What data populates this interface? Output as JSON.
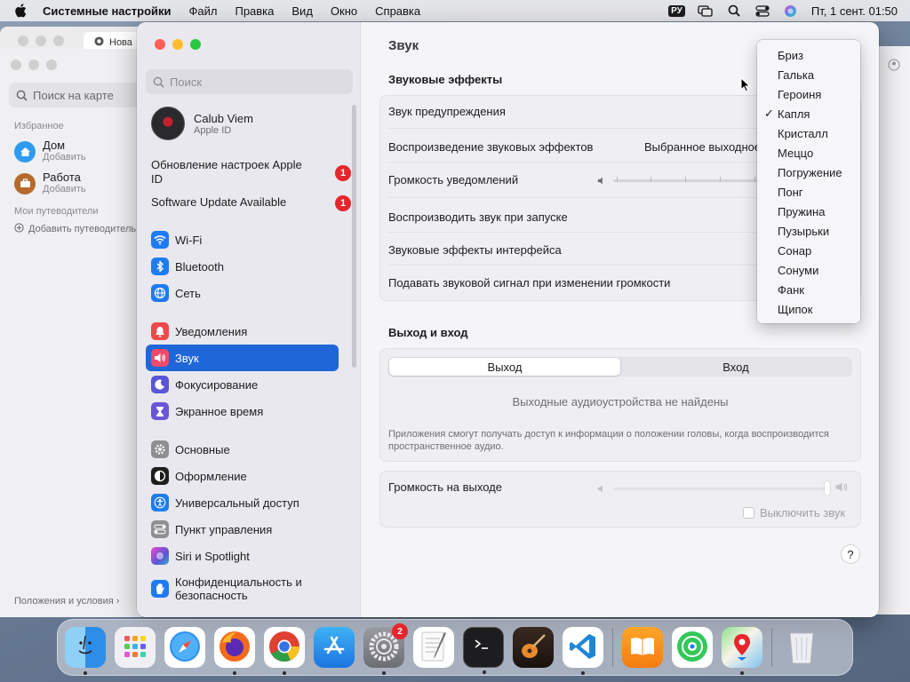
{
  "menubar": {
    "app_name": "Системные настройки",
    "items": [
      "Файл",
      "Правка",
      "Вид",
      "Окно",
      "Справка"
    ],
    "lang": "РУ",
    "clock": "Пт, 1 сент. 01:50"
  },
  "browser_tab": {
    "label": "Нова"
  },
  "maps": {
    "search_placeholder": "Поиск на карте",
    "favorites_title": "Избранное",
    "home_label": "Дом",
    "home_sub": "Добавить",
    "work_label": "Работа",
    "work_sub": "Добавить",
    "guides_title": "Мои путеводители",
    "add_guide": "Добавить путеводитель",
    "terms": "Положения и условия"
  },
  "sidebar": {
    "search_placeholder": "Поиск",
    "account": {
      "name": "Calub Viem",
      "sub": "Apple ID"
    },
    "notices": [
      {
        "label": "Обновление настроек Apple ID",
        "badge": "1"
      },
      {
        "label": "Software Update Available",
        "badge": "1"
      }
    ],
    "items": [
      {
        "label": "Wi-Fi",
        "icon": "wifi-icon",
        "color": "#1f7bf2"
      },
      {
        "label": "Bluetooth",
        "icon": "bluetooth-icon",
        "color": "#1f7bf2"
      },
      {
        "label": "Сеть",
        "icon": "globe-icon",
        "color": "#1f7bf2"
      },
      {
        "label": "Уведомления",
        "icon": "bell-icon",
        "color": "#ee4a4a"
      },
      {
        "label": "Звук",
        "icon": "speaker-icon",
        "color": "#ee4a6a"
      },
      {
        "label": "Фокусирование",
        "icon": "moon-icon",
        "color": "#5a54d6"
      },
      {
        "label": "Экранное время",
        "icon": "hourglass-icon",
        "color": "#6a55d6"
      },
      {
        "label": "Основные",
        "icon": "gear-icon",
        "color": "#8e8e93"
      },
      {
        "label": "Оформление",
        "icon": "appearance-icon",
        "color": "#1d1d1f"
      },
      {
        "label": "Универсальный доступ",
        "icon": "accessibility-icon",
        "color": "#1f7bf2"
      },
      {
        "label": "Пункт управления",
        "icon": "control-center-icon",
        "color": "#8e8e93"
      },
      {
        "label": "Siri и Spotlight",
        "icon": "siri-icon",
        "color": "#b04ad9"
      },
      {
        "label": "Конфиденциальность и безопасность",
        "icon": "hand-icon",
        "color": "#1f7bf2"
      }
    ]
  },
  "content": {
    "title": "Звук",
    "effects_title": "Звуковые эффекты",
    "alert_sound": "Звук предупреждения",
    "play_effects": "Воспроизведение звуковых эффектов",
    "play_effects_value": "Выбранное выходное",
    "alert_volume": "Громкость уведомлений",
    "startup_sound": "Воспроизводить звук при запуске",
    "ui_effects": "Звуковые эффекты интерфейса",
    "volume_feedback": "Подавать звуковой сигнал при изменении громкости",
    "io_title": "Выход и вход",
    "tab_output": "Выход",
    "tab_input": "Вход",
    "no_devices": "Выходные аудиоустройства не найдены",
    "spatial_info": "Приложения смогут получать доступ к информации о положении головы, когда воспроизводится пространственное аудио.",
    "output_volume": "Громкость на выходе",
    "mute": "Выключить звук",
    "help": "?"
  },
  "dropdown": {
    "selected": "Капля",
    "items": [
      "Бриз",
      "Галька",
      "Героиня",
      "Капля",
      "Кристалл",
      "Меццо",
      "Погружение",
      "Понг",
      "Пружина",
      "Пузырьки",
      "Сонар",
      "Сонуми",
      "Фанк",
      "Щипок"
    ]
  },
  "dock": {
    "settings_badge": "2"
  }
}
